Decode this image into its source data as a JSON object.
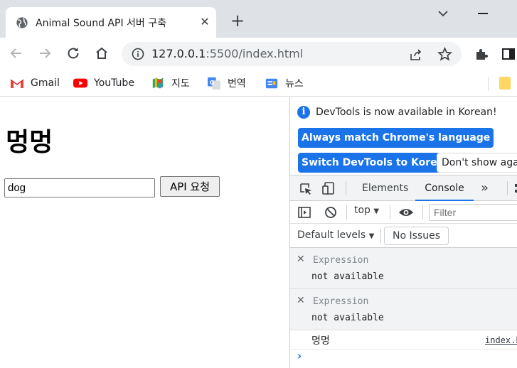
{
  "browser": {
    "tab": {
      "title": "Animal Sound API 서버 구축",
      "close": "✕"
    },
    "new_tab": "+",
    "address": {
      "host": "127.0.0.1",
      "port_path": ":5500/index.html"
    },
    "bookmarks": [
      {
        "label": "Gmail",
        "icon": "gmail-icon"
      },
      {
        "label": "YouTube",
        "icon": "youtube-icon"
      },
      {
        "label": "지도",
        "icon": "maps-icon"
      },
      {
        "label": "번역",
        "icon": "translate-icon"
      },
      {
        "label": "뉴스",
        "icon": "news-icon"
      }
    ]
  },
  "page": {
    "heading": "멍멍",
    "input_value": "dog",
    "button_label": "API 요청"
  },
  "devtools": {
    "infobar": {
      "message": "DevTools is now available in Korean!",
      "btn_match": "Always match Chrome's language",
      "btn_switch": "Switch DevTools to Korean",
      "btn_dont": "Don't show again"
    },
    "tabs": {
      "elements": "Elements",
      "console": "Console",
      "more": "»"
    },
    "toolbar": {
      "context": "top",
      "filter_placeholder": "Filter",
      "levels": "Default levels",
      "issues": "No Issues"
    },
    "expressions": [
      {
        "name": "Expression",
        "value": "not available"
      },
      {
        "name": "Expression",
        "value": "not available"
      }
    ],
    "log": {
      "message": "멍멍",
      "source": "index.html"
    },
    "prompt": "›"
  },
  "colors": {
    "accent": "#1a73e8",
    "tabstrip": "#dee1e6",
    "omnibox": "#f1f3f4"
  }
}
